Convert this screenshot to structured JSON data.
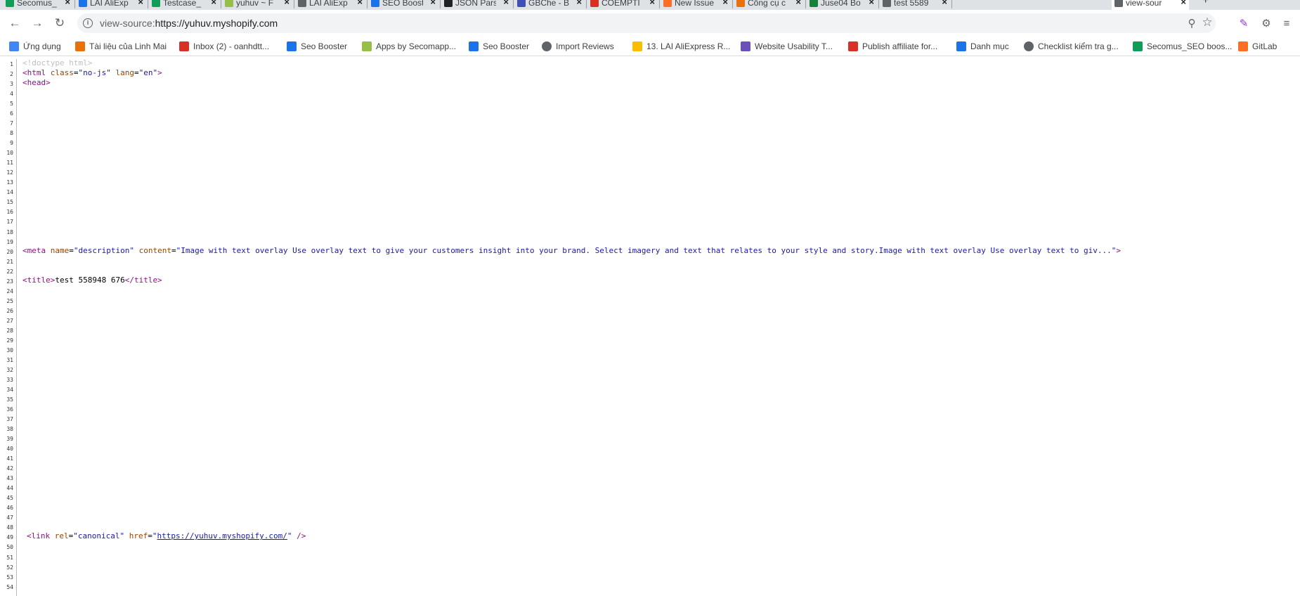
{
  "tabs": [
    {
      "label": "Secomus_",
      "favicon": "green-sheet",
      "color": "#0f9d58"
    },
    {
      "label": "LAI AliExp",
      "favicon": "blue-c",
      "color": "#1a73e8"
    },
    {
      "label": "Testcase_",
      "favicon": "green-sheet",
      "color": "#0f9d58"
    },
    {
      "label": "yuhuv ~ F",
      "favicon": "shopify",
      "color": "#95bf47"
    },
    {
      "label": "LAI AliExp",
      "favicon": "globe",
      "color": "#5f6368"
    },
    {
      "label": "SEO Boost",
      "favicon": "seo-s",
      "color": "#1a73e8"
    },
    {
      "label": "JSON Parse",
      "favicon": "json",
      "color": "#202124"
    },
    {
      "label": "GBChe - B",
      "favicon": "blue-circle",
      "color": "#3f51b5"
    },
    {
      "label": "COEMPTI",
      "favicon": "red-square",
      "color": "#d93025"
    },
    {
      "label": "New Issue",
      "favicon": "gitlab",
      "color": "#fc6d26"
    },
    {
      "label": "Công cụ c",
      "favicon": "tool",
      "color": "#e8710a"
    },
    {
      "label": "Juse04 Bo",
      "favicon": "green-doc",
      "color": "#188038"
    },
    {
      "label": "test 5589",
      "favicon": "globe",
      "color": "#5f6368"
    },
    {
      "label": "view-sour",
      "favicon": "globe",
      "color": "#5f6368"
    }
  ],
  "address_bar": {
    "scheme": "view-source:",
    "url": "https://yuhuv.myshopify.com"
  },
  "bookmarks": [
    {
      "label": "Ứng dụng",
      "icon": "apps-grid-icon",
      "color": "#4285f4"
    },
    {
      "label": "Tài liệu của Linh Mai",
      "icon": "123-icon",
      "color": "#e8710a"
    },
    {
      "label": "Inbox (2) - oanhdtt...",
      "icon": "gmail-icon",
      "color": "#d93025"
    },
    {
      "label": "Seo Booster",
      "icon": "seo-booster-icon",
      "color": "#1a73e8"
    },
    {
      "label": "Apps by Secomapp...",
      "icon": "shopify-icon",
      "color": "#95bf47"
    },
    {
      "label": "Seo Booster",
      "icon": "seo-booster-icon",
      "color": "#1a73e8"
    },
    {
      "label": "Import Reviews",
      "icon": "globe-icon",
      "color": "#5f6368"
    },
    {
      "label": "13. LAI AliExpress R...",
      "icon": "drive-icon",
      "color": "#fbbc04"
    },
    {
      "label": "Website Usability T...",
      "icon": "usability-icon",
      "color": "#6b4fbb"
    },
    {
      "label": "Publish affiliate for...",
      "icon": "affiliate-icon",
      "color": "#d93025"
    },
    {
      "label": "Danh mục",
      "icon": "seo-booster-icon",
      "color": "#1a73e8"
    },
    {
      "label": "Checklist kiểm tra g...",
      "icon": "globe-icon",
      "color": "#5f6368"
    },
    {
      "label": "Secomus_SEO boos...",
      "icon": "sheets-icon",
      "color": "#0f9d58"
    },
    {
      "label": "GitLab",
      "icon": "gitlab-icon",
      "color": "#fc6d26"
    }
  ],
  "source": {
    "line_count": 54,
    "lines": {
      "1": {
        "comment": "<!doctype html>"
      },
      "2": {
        "tag_open": "<html",
        "a1": "class",
        "v1": "\"no-js\"",
        "a2": "lang",
        "v2": "\"en\"",
        "tag_close": ">"
      },
      "3": {
        "tag": "<head>"
      },
      "20": {
        "tag_open": "<meta",
        "a1": "name",
        "v1": "\"description\"",
        "a2": "content",
        "v2": "\"Image with text overlay Use overlay text to give your customers insight into your brand. Select imagery and text that relates to your style and story.Image with text overlay Use overlay text to giv...\"",
        "tag_close": ">"
      },
      "23": {
        "tag_open": "<title>",
        "text": "test 558948 676",
        "tag_close": "</title>"
      },
      "49": {
        "tag_open": "<link",
        "a1": "rel",
        "v1": "\"canonical\"",
        "a2": "href",
        "q1": "\"",
        "link": "https://yuhuv.myshopify.com/",
        "q2": "\"",
        "tag_close": " />"
      }
    }
  }
}
